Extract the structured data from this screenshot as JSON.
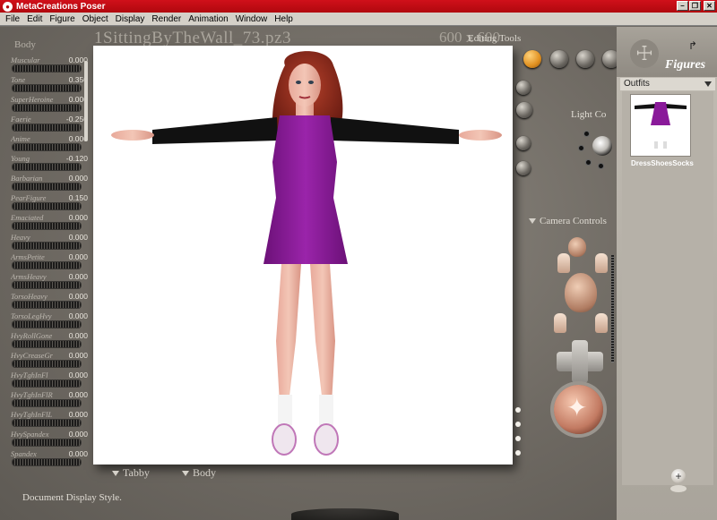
{
  "window": {
    "title": "MetaCreations Poser"
  },
  "menu": [
    "File",
    "Edit",
    "Figure",
    "Object",
    "Display",
    "Render",
    "Animation",
    "Window",
    "Help"
  ],
  "document": {
    "title": "1SittingByTheWall_73.pz3",
    "size": "600 x 600"
  },
  "editing_tools_label": "Editing Tools",
  "left_panel": {
    "heading": "Body",
    "dials": [
      {
        "label": "Muscular",
        "value": "0.000"
      },
      {
        "label": "Tone",
        "value": "0.350"
      },
      {
        "label": "SuperHeroine",
        "value": "0.000"
      },
      {
        "label": "Faerie",
        "value": "-0.250"
      },
      {
        "label": "Anime",
        "value": "0.000"
      },
      {
        "label": "Young",
        "value": "-0.120"
      },
      {
        "label": "Barbarian",
        "value": "0.000"
      },
      {
        "label": "PearFigure",
        "value": "0.150"
      },
      {
        "label": "Emaciated",
        "value": "0.000"
      },
      {
        "label": "Heavy",
        "value": "0.000"
      },
      {
        "label": "ArmsPetite",
        "value": "0.000"
      },
      {
        "label": "ArmsHeavy",
        "value": "0.000"
      },
      {
        "label": "TorsoHeavy",
        "value": "0.000"
      },
      {
        "label": "TorsoLegHvy",
        "value": "0.000"
      },
      {
        "label": "HvyRollGone",
        "value": "0.000"
      },
      {
        "label": "HvyCreaseGr",
        "value": "0.000"
      },
      {
        "label": "HvyTghInFl",
        "value": "0.000"
      },
      {
        "label": "HvyTghInFlR",
        "value": "0.000"
      },
      {
        "label": "HvyTghInFlL",
        "value": "0.000"
      },
      {
        "label": "HvySpandex",
        "value": "0.000"
      },
      {
        "label": "Spandex",
        "value": "0.000"
      }
    ]
  },
  "bottom": {
    "figure_selector": "Tabby",
    "part_selector": "Body",
    "doc_display_style": "Document Display Style."
  },
  "light_controls_label": "Light Co",
  "camera_controls_label": "Camera Controls",
  "library": {
    "title": "Figures",
    "category": "Outfits",
    "items": [
      {
        "label": "DressShoesSocks"
      }
    ]
  },
  "colors": {
    "dress": "#8a1a9a",
    "titlebar": "#c0101a",
    "canvas": "#ffffff"
  }
}
